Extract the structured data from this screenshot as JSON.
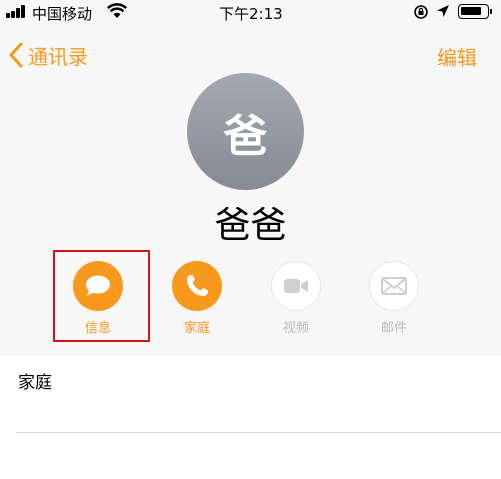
{
  "status_bar": {
    "carrier": "中国移动",
    "time": "下午2:13"
  },
  "nav": {
    "back_label": "通讯录",
    "edit_label": "编辑"
  },
  "contact": {
    "avatar_text": "爸",
    "name": "爸爸"
  },
  "actions": [
    {
      "label": "信息",
      "icon": "message-icon",
      "enabled": true
    },
    {
      "label": "家庭",
      "icon": "phone-icon",
      "enabled": true
    },
    {
      "label": "视频",
      "icon": "video-icon",
      "enabled": false
    },
    {
      "label": "邮件",
      "icon": "mail-icon",
      "enabled": false
    }
  ],
  "phone_section": {
    "label": "家庭"
  },
  "colors": {
    "accent": "#f7991c",
    "highlight_border": "#d0141d",
    "avatar": "#959aa4",
    "disabled_text": "#b9b9b9"
  }
}
